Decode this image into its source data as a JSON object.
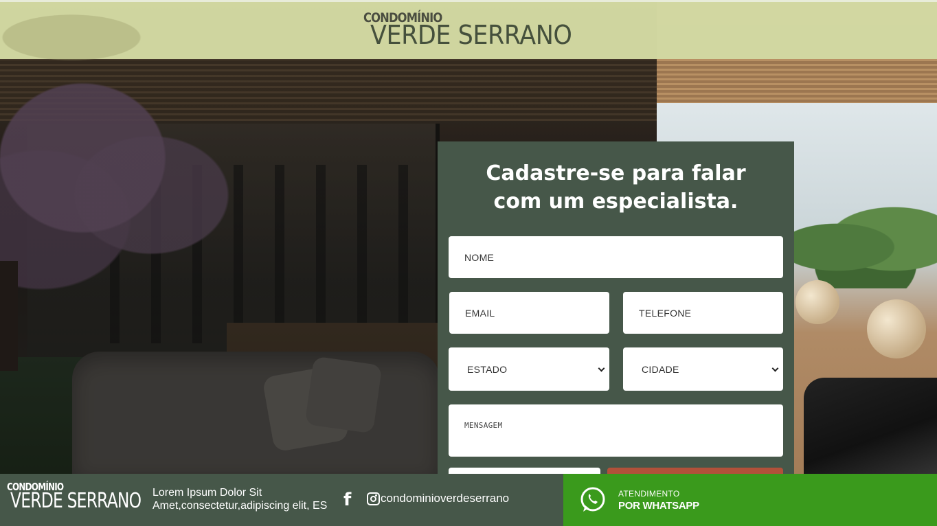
{
  "header": {
    "logo_top": "CONDOMÍNIO",
    "logo_main": "VERDE SERRANO"
  },
  "form": {
    "title_line1": "Cadastre-se para falar",
    "title_line2": "com um especialista.",
    "nome_placeholder": "NOME",
    "email_placeholder": "EMAIL",
    "telefone_placeholder": "TELEFONE",
    "estado_selected": "ESTADO",
    "cidade_selected": "CIDADE",
    "mensagem_placeholder": "MENSAGEM"
  },
  "footer": {
    "logo_top": "CONDOMÍNIO",
    "logo_main": "VERDE SERRANO",
    "text": "Lorem Ipsum Dolor Sit Amet,consectetur,adipiscing elit, ES",
    "instagram_handle": "condominioverdeserrano",
    "whatsapp_small": "ATENDIMENTO",
    "whatsapp_big": "POR WHATSAPP"
  },
  "icons": {
    "facebook": "facebook-icon",
    "instagram": "instagram-icon",
    "whatsapp": "whatsapp-icon",
    "select_chevron": "chevron-down-icon"
  },
  "colors": {
    "panel": "#465749",
    "header": "#dce4aa",
    "send_button": "#b2513a",
    "whatsapp": "#3a9a1c"
  }
}
